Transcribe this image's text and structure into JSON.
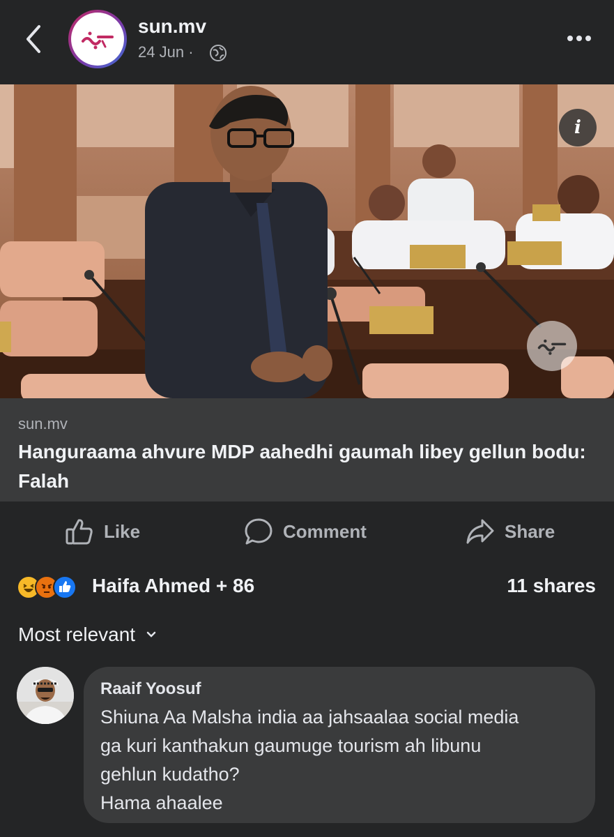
{
  "header": {
    "page_name": "sun.mv",
    "date": "24 Jun",
    "separator": "·",
    "icons": [
      "back-chevron-icon",
      "globe-icon",
      "more-icon"
    ]
  },
  "photo": {
    "info_glyph": "i"
  },
  "link": {
    "domain": "sun.mv",
    "title": "Hanguraama ahvure MDP aahedhi gaumah libey gellun bodu: Falah"
  },
  "actions": {
    "like": "Like",
    "comment": "Comment",
    "share": "Share"
  },
  "stats": {
    "reactors": "Haifa Ahmed + 86",
    "shares": "11 shares",
    "reaction_icons": [
      "haha-icon",
      "angry-icon",
      "like-icon"
    ]
  },
  "sort": {
    "label": "Most relevant"
  },
  "comment": {
    "author": "Raaif Yoosuf",
    "lines": [
      "Shiuna Aa Malsha india aa jahsaalaa social media",
      "ga kuri kanthakun gaumuge tourism ah libunu",
      "gehlun kudatho?",
      "Hama ahaalee"
    ]
  },
  "colors": {
    "background": "#242526",
    "card": "#3a3b3c",
    "text": "#e4e6eb",
    "muted": "#b0b3b8",
    "like_blue": "#1877f2"
  }
}
